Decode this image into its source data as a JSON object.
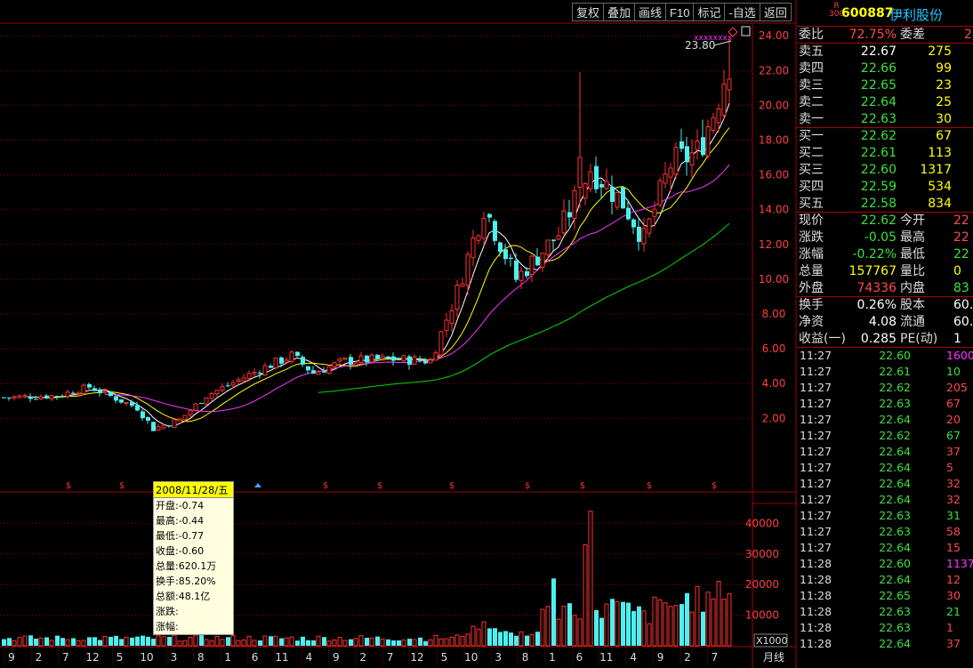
{
  "toolbar": [
    "复权",
    "叠加",
    "画线",
    "F10",
    "标记",
    "-自选",
    "返回"
  ],
  "chart": {
    "price_axis": [
      "24.00",
      "22.00",
      "20.00",
      "18.00",
      "16.00",
      "14.00",
      "12.00",
      "10.00",
      "8.00",
      "6.00",
      "4.00",
      "2.00"
    ],
    "volume_axis": [
      "40000",
      "30000",
      "20000",
      "10000"
    ],
    "volume_unit": "X1000",
    "period_label": "月线",
    "month_labels": [
      "9",
      "2",
      "7",
      "12",
      "5",
      "10",
      "3",
      "8",
      "1",
      "6",
      "11",
      "4",
      "9",
      "2",
      "7",
      "12",
      "5",
      "10",
      "3",
      "8",
      "1",
      "6",
      "11",
      "4",
      "9",
      "2",
      "7"
    ],
    "high_marker": "23.80",
    "event_marker": "$",
    "colors": {
      "up": "#ff3232",
      "down": "#4cf0f0",
      "ma5": "#ffffff",
      "ma10": "#ffff00",
      "ma20": "#ff33ff",
      "ma60": "#00d800",
      "grid": "#a00000"
    }
  },
  "tooltip": {
    "date": "2008/11/28/五",
    "rows": [
      "开盘:-0.74",
      "最高:-0.44",
      "最低:-0.77",
      "收盘:-0.60",
      "总量:620.1万",
      "换手:85.20%",
      "总额:48.1亿",
      "涨跌:",
      "涨幅:"
    ]
  },
  "quote": {
    "market_badge_top": "R",
    "market_badge_bottom": "300",
    "code": "600887",
    "name": "伊利股份",
    "ratio": {
      "label1": "委比",
      "value1": "72.75%",
      "label2": "委差",
      "value2": "2"
    },
    "asks": [
      {
        "label": "卖五",
        "price": "22.67",
        "vol": "275"
      },
      {
        "label": "卖四",
        "price": "22.66",
        "vol": "99"
      },
      {
        "label": "卖三",
        "price": "22.65",
        "vol": "23"
      },
      {
        "label": "卖二",
        "price": "22.64",
        "vol": "25"
      },
      {
        "label": "卖一",
        "price": "22.63",
        "vol": "30"
      }
    ],
    "bids": [
      {
        "label": "买一",
        "price": "22.62",
        "vol": "67"
      },
      {
        "label": "买二",
        "price": "22.61",
        "vol": "113"
      },
      {
        "label": "买三",
        "price": "22.60",
        "vol": "1317"
      },
      {
        "label": "买四",
        "price": "22.59",
        "vol": "534"
      },
      {
        "label": "买五",
        "price": "22.58",
        "vol": "834"
      }
    ],
    "stats": [
      {
        "l1": "现价",
        "v1": "22.62",
        "c1": "green",
        "l2": "今开",
        "v2": "22",
        "c2": "red"
      },
      {
        "l1": "涨跌",
        "v1": "-0.05",
        "c1": "green",
        "l2": "最高",
        "v2": "22",
        "c2": "red"
      },
      {
        "l1": "涨幅",
        "v1": "-0.22%",
        "c1": "green",
        "l2": "最低",
        "v2": "22",
        "c2": "green"
      },
      {
        "l1": "总量",
        "v1": "157767",
        "c1": "yellow",
        "l2": "量比",
        "v2": "0",
        "c2": "yellow"
      },
      {
        "l1": "外盘",
        "v1": "74336",
        "c1": "red",
        "l2": "内盘",
        "v2": "83",
        "c2": "green"
      }
    ],
    "stats2": [
      {
        "l1": "换手",
        "v1": "0.26%",
        "c1": "white",
        "l2": "股本",
        "v2": "60.",
        "c2": "white"
      },
      {
        "l1": "净资",
        "v1": "4.08",
        "c1": "white",
        "l2": "流通",
        "v2": "60.",
        "c2": "white"
      },
      {
        "l1": "收益(一)",
        "v1": "0.285",
        "c1": "white",
        "l2": "PE(动)",
        "v2": "1",
        "c2": "white"
      }
    ],
    "ticks": [
      {
        "time": "11:27",
        "price": "22.60",
        "vol": "1600",
        "c": "mag"
      },
      {
        "time": "11:27",
        "price": "22.61",
        "vol": "10",
        "c": "green"
      },
      {
        "time": "11:27",
        "price": "22.62",
        "vol": "205",
        "c": "red"
      },
      {
        "time": "11:27",
        "price": "22.63",
        "vol": "67",
        "c": "red"
      },
      {
        "time": "11:27",
        "price": "22.64",
        "vol": "20",
        "c": "red"
      },
      {
        "time": "11:27",
        "price": "22.62",
        "vol": "67",
        "c": "green"
      },
      {
        "time": "11:27",
        "price": "22.64",
        "vol": "37",
        "c": "red"
      },
      {
        "time": "11:27",
        "price": "22.64",
        "vol": "5",
        "c": "red"
      },
      {
        "time": "11:27",
        "price": "22.64",
        "vol": "32",
        "c": "red"
      },
      {
        "time": "11:27",
        "price": "22.64",
        "vol": "32",
        "c": "red"
      },
      {
        "time": "11:27",
        "price": "22.63",
        "vol": "31",
        "c": "green"
      },
      {
        "time": "11:27",
        "price": "22.63",
        "vol": "58",
        "c": "red"
      },
      {
        "time": "11:27",
        "price": "22.64",
        "vol": "15",
        "c": "red"
      },
      {
        "time": "11:28",
        "price": "22.60",
        "vol": "1137",
        "c": "mag"
      },
      {
        "time": "11:28",
        "price": "22.64",
        "vol": "12",
        "c": "red"
      },
      {
        "time": "11:28",
        "price": "22.65",
        "vol": "30",
        "c": "red"
      },
      {
        "time": "11:28",
        "price": "22.63",
        "vol": "21",
        "c": "green"
      },
      {
        "time": "11:28",
        "price": "22.63",
        "vol": "1",
        "c": "red"
      },
      {
        "time": "11:28",
        "price": "22.64",
        "vol": "37",
        "c": "red"
      }
    ]
  }
}
